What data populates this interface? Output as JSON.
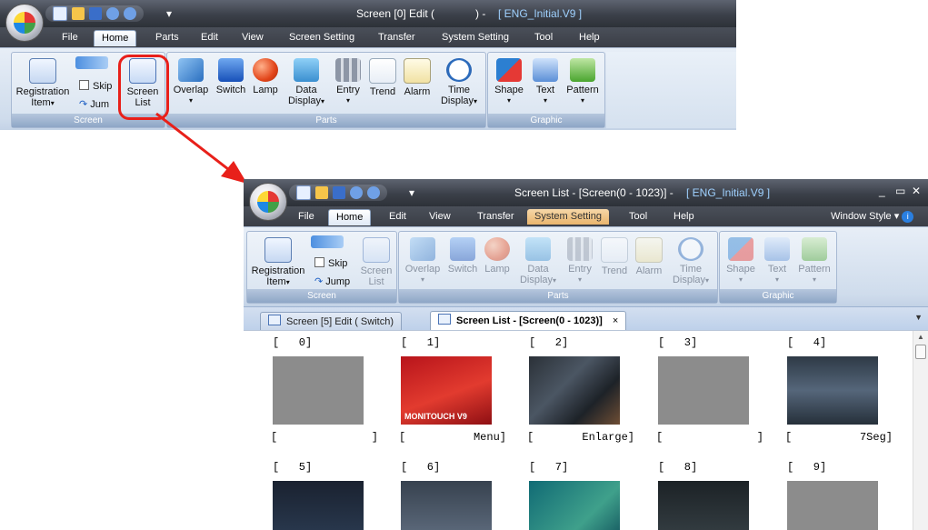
{
  "small_window": {
    "title": "Screen [0] Edit (",
    "title_mid": ") - ",
    "title_file": "[ ENG_Initial.V9 ]",
    "tabs": [
      "File",
      "Home",
      "Parts",
      "Edit",
      "View",
      "Screen Setting",
      "Transfer",
      "System Setting",
      "Tool",
      "Help"
    ],
    "groups": {
      "screen": "Screen",
      "parts": "Parts",
      "graphic": "Graphic"
    },
    "buttons": {
      "registration_item": "Registration",
      "registration_item_line2": "Item",
      "skip": "Skip",
      "jump": "Jum",
      "screen_list_1": "Screen",
      "screen_list_2": "List",
      "overlap": "Overlap",
      "switch": "Switch",
      "lamp": "Lamp",
      "data_display_1": "Data",
      "data_display_2": "Display",
      "entry": "Entry",
      "trend": "Trend",
      "alarm": "Alarm",
      "time_display_1": "Time",
      "time_display_2": "Display",
      "shape": "Shape",
      "text": "Text",
      "pattern": "Pattern"
    },
    "highlight_color": "#e8201a"
  },
  "large_window": {
    "title": "Screen List - [Screen(0 - 1023)] - ",
    "title_file": "[ ENG_Initial.V9 ]",
    "window_style": "Window Style",
    "tabs": [
      "File",
      "Home",
      "Edit",
      "View",
      "Transfer",
      "System Setting",
      "Tool",
      "Help"
    ],
    "groups": {
      "screen": "Screen",
      "parts": "Parts",
      "graphic": "Graphic"
    },
    "buttons": {
      "registration_item": "Registration",
      "registration_item_line2": "Item",
      "skip": "Skip",
      "jump": "Jump",
      "screen_list_1": "Screen",
      "screen_list_2": "List",
      "overlap": "Overlap",
      "switch": "Switch",
      "lamp": "Lamp",
      "data_display_1": "Data",
      "data_display_2": "Display",
      "entry": "Entry",
      "trend": "Trend",
      "alarm": "Alarm",
      "time_display_1": "Time",
      "time_display_2": "Display",
      "shape": "Shape",
      "text": "Text",
      "pattern": "Pattern"
    },
    "doc_tabs": [
      {
        "label": "Screen [5] Edit (        Switch)"
      },
      {
        "label": "Screen List - [Screen(0 - 1023)]"
      }
    ],
    "close_glyph": "×",
    "screens": [
      {
        "num": "[   0]",
        "name": ""
      },
      {
        "num": "[   1]",
        "name": "Menu"
      },
      {
        "num": "[   2]",
        "name": "Enlarge"
      },
      {
        "num": "[   3]",
        "name": ""
      },
      {
        "num": "[   4]",
        "name": "7Seg"
      },
      {
        "num": "[   5]",
        "name": ""
      },
      {
        "num": "[   6]",
        "name": ""
      },
      {
        "num": "[   7]",
        "name": ""
      },
      {
        "num": "[   8]",
        "name": ""
      },
      {
        "num": "[   9]",
        "name": ""
      }
    ],
    "thumb_labels": {
      "menu_logo": "MONITOUCH V9"
    }
  }
}
